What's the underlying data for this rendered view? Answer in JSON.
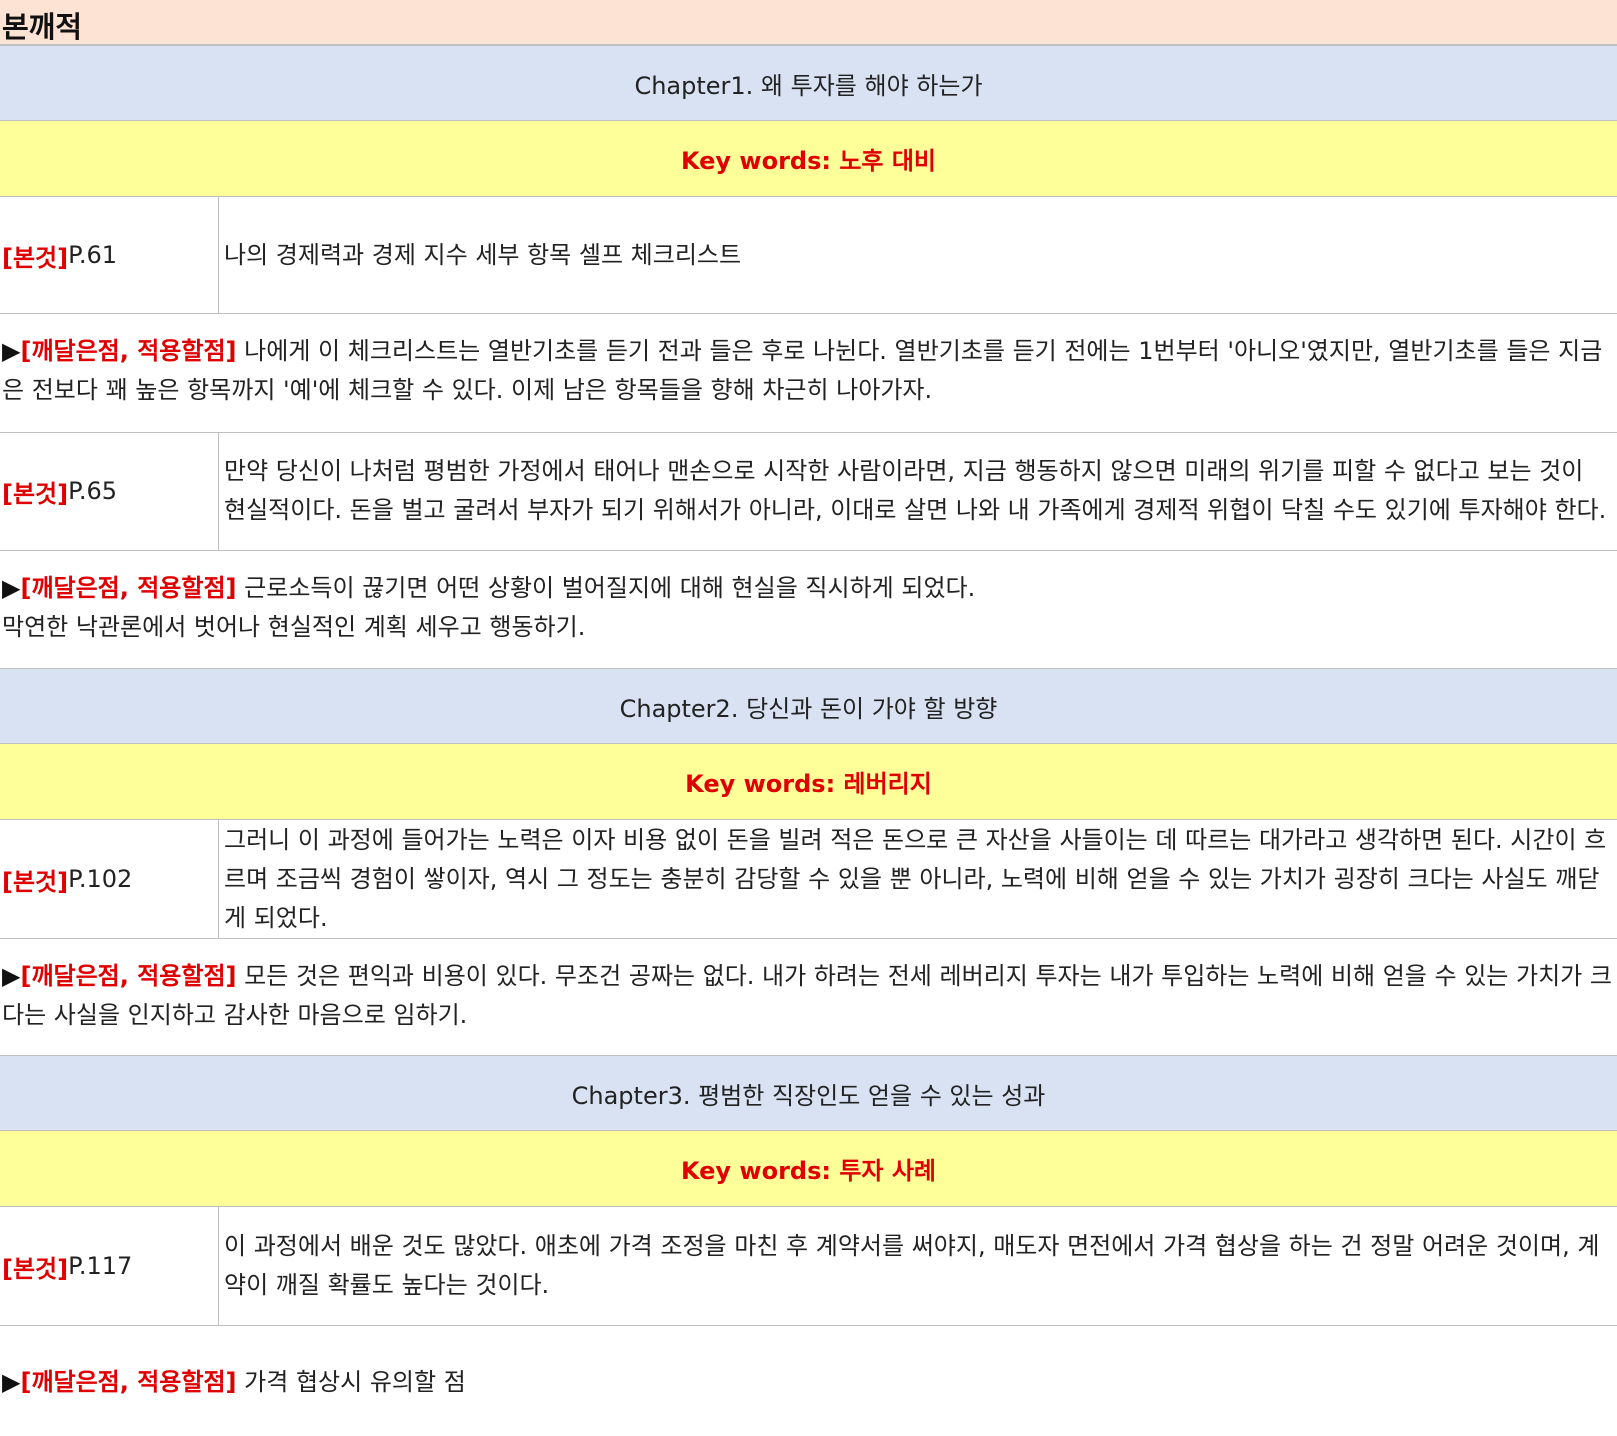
{
  "title": "본깨적",
  "labels": {
    "quote_tag": "[본것]",
    "insight_marker": "▶",
    "insight_tag": "[깨달은점, 적용할점]"
  },
  "sections": [
    {
      "chapter": "Chapter1. 왜 투자를 해야 하는가",
      "keywords": "Key words: 노후 대비",
      "entries": [
        {
          "page": "P.61",
          "quote": "나의 경제력과 경제 지수 세부 항목 셀프 체크리스트",
          "insight": "나에게 이 체크리스트는 열반기초를 듣기 전과 들은 후로 나뉜다. 열반기초를 듣기 전에는 1번부터 '아니오'였지만, 열반기초를 들은 지금은 전보다 꽤 높은 항목까지 '예'에 체크할 수 있다. 이제 남은 항목들을 향해 차근히 나아가자."
        },
        {
          "page": "P.65",
          "quote": "만약 당신이 나처럼 평범한 가정에서 태어나 맨손으로 시작한 사람이라면, 지금 행동하지 않으면 미래의 위기를 피할 수 없다고 보는 것이 현실적이다. 돈을 벌고 굴려서 부자가 되기 위해서가 아니라, 이대로 살면 나와 내 가족에게 경제적 위협이 닥칠 수도 있기에 투자해야 한다.",
          "insight": "근로소득이 끊기면 어떤 상황이 벌어질지에 대해 현실을 직시하게 되었다.",
          "insight_line2": "막연한 낙관론에서 벗어나 현실적인 계획 세우고 행동하기."
        }
      ]
    },
    {
      "chapter": "Chapter2. 당신과 돈이 가야 할 방향",
      "keywords": "Key words: 레버리지",
      "entries": [
        {
          "page": "P.102",
          "quote": "그러니 이 과정에 들어가는 노력은 이자 비용 없이 돈을 빌려 적은 돈으로 큰 자산을 사들이는 데 따르는 대가라고 생각하면 된다. 시간이 흐르며 조금씩 경험이 쌓이자, 역시 그 정도는 충분히 감당할 수 있을 뿐 아니라, 노력에 비해 얻을 수 있는 가치가 굉장히 크다는 사실도 깨닫게 되었다.",
          "insight": "모든 것은 편익과 비용이 있다. 무조건 공짜는 없다. 내가 하려는 전세 레버리지 투자는 내가 투입하는 노력에 비해 얻을 수 있는 가치가 크다는 사실을 인지하고 감사한 마음으로 임하기."
        }
      ]
    },
    {
      "chapter": "Chapter3. 평범한 직장인도 얻을 수 있는 성과",
      "keywords": "Key words: 투자 사례",
      "entries": [
        {
          "page": "P.117",
          "quote": "이 과정에서 배운 것도 많았다. 애초에 가격 조정을 마친 후 계약서를 써야지, 매도자 면전에서 가격 협상을 하는 건 정말 어려운 것이며, 계약이 깨질 확률도 높다는 것이다.",
          "insight": "가격 협상시 유의할 점"
        }
      ]
    }
  ]
}
